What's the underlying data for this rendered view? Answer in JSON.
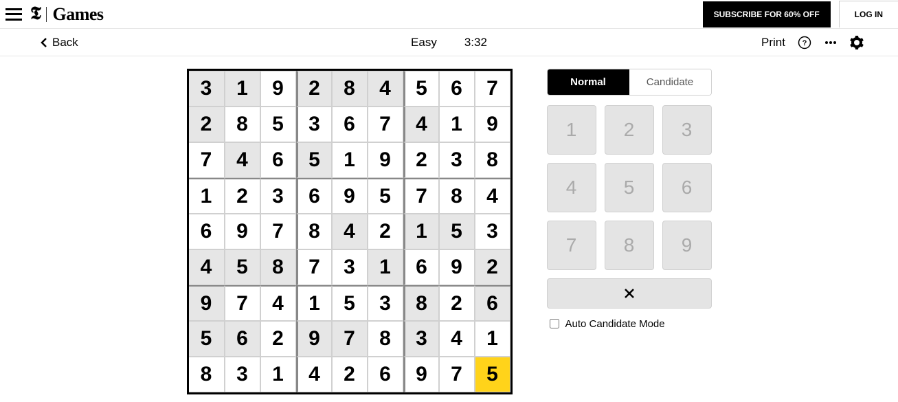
{
  "nav": {
    "brand_t": "𝕿",
    "brand_games": "Games",
    "subscribe": "SUBSCRIBE FOR 60% OFF",
    "login": "LOG IN"
  },
  "toolbar": {
    "back": "Back",
    "difficulty": "Easy",
    "time": "3:32",
    "print": "Print"
  },
  "panel": {
    "mode_normal": "Normal",
    "mode_candidate": "Candidate",
    "keys": [
      "1",
      "2",
      "3",
      "4",
      "5",
      "6",
      "7",
      "8",
      "9"
    ],
    "auto_label": "Auto Candidate Mode"
  },
  "board": {
    "grid": [
      [
        {
          "v": "3",
          "p": true
        },
        {
          "v": "1",
          "p": true
        },
        {
          "v": "9",
          "p": false
        },
        {
          "v": "2",
          "p": true
        },
        {
          "v": "8",
          "p": true
        },
        {
          "v": "4",
          "p": true
        },
        {
          "v": "5",
          "p": false
        },
        {
          "v": "6",
          "p": false
        },
        {
          "v": "7",
          "p": false
        }
      ],
      [
        {
          "v": "2",
          "p": true
        },
        {
          "v": "8",
          "p": false
        },
        {
          "v": "5",
          "p": false
        },
        {
          "v": "3",
          "p": false
        },
        {
          "v": "6",
          "p": false
        },
        {
          "v": "7",
          "p": false
        },
        {
          "v": "4",
          "p": true
        },
        {
          "v": "1",
          "p": false
        },
        {
          "v": "9",
          "p": false
        }
      ],
      [
        {
          "v": "7",
          "p": false
        },
        {
          "v": "4",
          "p": true
        },
        {
          "v": "6",
          "p": false
        },
        {
          "v": "5",
          "p": true
        },
        {
          "v": "1",
          "p": false
        },
        {
          "v": "9",
          "p": false
        },
        {
          "v": "2",
          "p": false
        },
        {
          "v": "3",
          "p": false
        },
        {
          "v": "8",
          "p": false
        }
      ],
      [
        {
          "v": "1",
          "p": false
        },
        {
          "v": "2",
          "p": false
        },
        {
          "v": "3",
          "p": false
        },
        {
          "v": "6",
          "p": false
        },
        {
          "v": "9",
          "p": false
        },
        {
          "v": "5",
          "p": false
        },
        {
          "v": "7",
          "p": false
        },
        {
          "v": "8",
          "p": false
        },
        {
          "v": "4",
          "p": false
        }
      ],
      [
        {
          "v": "6",
          "p": false
        },
        {
          "v": "9",
          "p": false
        },
        {
          "v": "7",
          "p": false
        },
        {
          "v": "8",
          "p": false
        },
        {
          "v": "4",
          "p": true
        },
        {
          "v": "2",
          "p": false
        },
        {
          "v": "1",
          "p": true
        },
        {
          "v": "5",
          "p": true
        },
        {
          "v": "3",
          "p": false
        }
      ],
      [
        {
          "v": "4",
          "p": true
        },
        {
          "v": "5",
          "p": true
        },
        {
          "v": "8",
          "p": true
        },
        {
          "v": "7",
          "p": false
        },
        {
          "v": "3",
          "p": false
        },
        {
          "v": "1",
          "p": true
        },
        {
          "v": "6",
          "p": false
        },
        {
          "v": "9",
          "p": false
        },
        {
          "v": "2",
          "p": true
        }
      ],
      [
        {
          "v": "9",
          "p": true
        },
        {
          "v": "7",
          "p": false
        },
        {
          "v": "4",
          "p": false
        },
        {
          "v": "1",
          "p": false
        },
        {
          "v": "5",
          "p": false
        },
        {
          "v": "3",
          "p": false
        },
        {
          "v": "8",
          "p": true
        },
        {
          "v": "2",
          "p": false
        },
        {
          "v": "6",
          "p": true
        }
      ],
      [
        {
          "v": "5",
          "p": true
        },
        {
          "v": "6",
          "p": true
        },
        {
          "v": "2",
          "p": false
        },
        {
          "v": "9",
          "p": true
        },
        {
          "v": "7",
          "p": true
        },
        {
          "v": "8",
          "p": false
        },
        {
          "v": "3",
          "p": true
        },
        {
          "v": "4",
          "p": false
        },
        {
          "v": "1",
          "p": false
        }
      ],
      [
        {
          "v": "8",
          "p": false
        },
        {
          "v": "3",
          "p": false
        },
        {
          "v": "1",
          "p": false
        },
        {
          "v": "4",
          "p": false
        },
        {
          "v": "2",
          "p": false
        },
        {
          "v": "6",
          "p": false
        },
        {
          "v": "9",
          "p": false
        },
        {
          "v": "7",
          "p": false
        },
        {
          "v": "5",
          "p": false,
          "sel": true
        }
      ]
    ]
  }
}
